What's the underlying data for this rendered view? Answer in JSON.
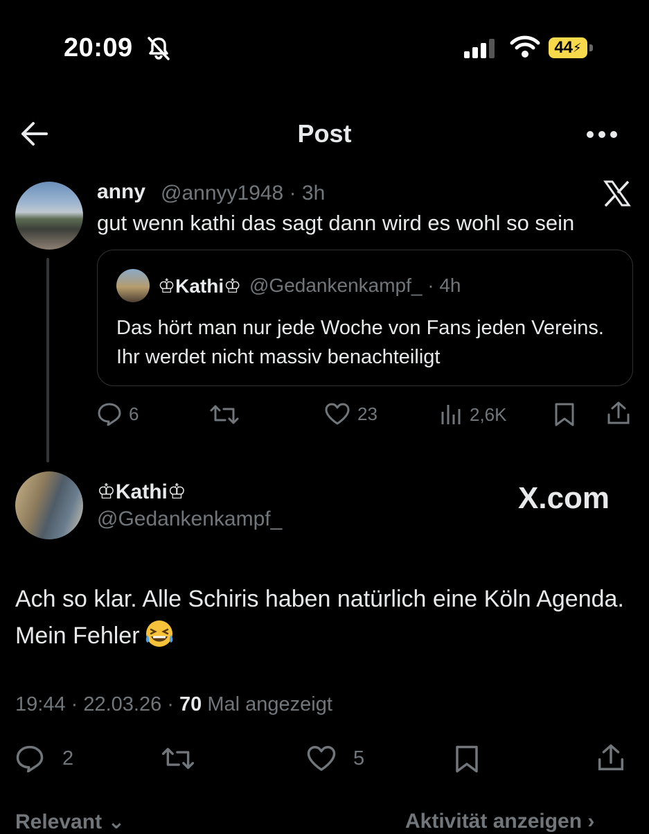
{
  "status_bar": {
    "time": "20:09",
    "battery": "44"
  },
  "header": {
    "title": "Post"
  },
  "reply": {
    "name": "anny",
    "handle_time": "@annyy1948 · 3h",
    "text": "gut wenn kathi das sagt dann wird es wohl so sein",
    "quote": {
      "name": "♔Kathi♔",
      "handle_time": "@Gedankenkampf_ · 4h",
      "text": "Das hört man nur jede Woche von Fans jeden Vereins. Ihr werdet nicht massiv benachteiligt"
    },
    "stats": {
      "replies": "6",
      "likes": "23",
      "views": "2,6K"
    }
  },
  "main": {
    "name": "♔Kathi♔",
    "handle": "@Gedankenkampf_",
    "watermark": "X.com",
    "text": "Ach so klar. Alle Schiris haben natürlich eine Köln Agenda. Mein Fehler",
    "time_date": "19:44 · 22.03.26 · ",
    "views_count": "70",
    "views_label": " Mal angezeigt",
    "stats": {
      "replies": "2",
      "likes": "5"
    }
  },
  "footer": {
    "sort": "Relevant ⌄",
    "activity": "Aktivität anzeigen ›"
  },
  "colors": {
    "background": "#000000",
    "text": "#e7e9ea",
    "muted": "#71767b",
    "battery": "#f7d94c"
  },
  "icons": [
    "bell-slash-icon",
    "signal-icon",
    "wifi-icon",
    "battery-icon",
    "back-arrow-icon",
    "more-icon",
    "x-logo-icon",
    "reply-icon",
    "retweet-icon",
    "like-icon",
    "views-icon",
    "bookmark-icon",
    "share-icon",
    "laughing-emoji-icon"
  ]
}
